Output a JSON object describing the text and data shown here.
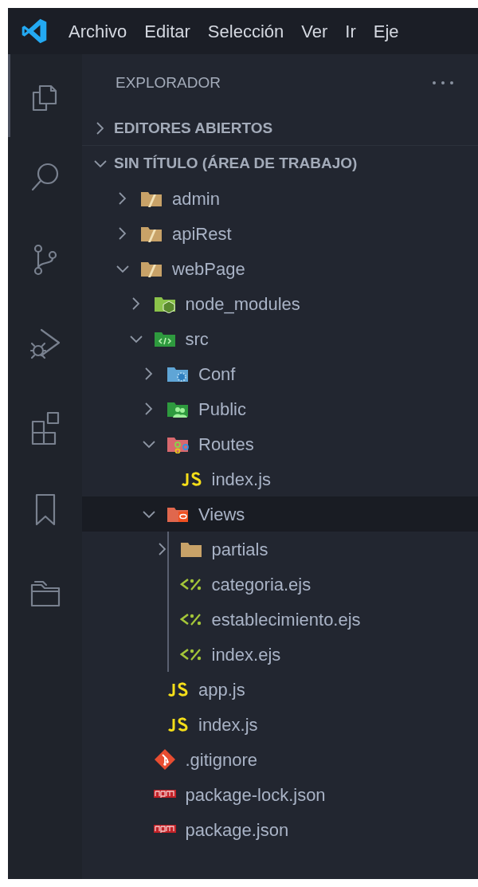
{
  "title_bar": {
    "menu": [
      "Archivo",
      "Editar",
      "Selección",
      "Ver",
      "Ir",
      "Eje"
    ]
  },
  "activity_bar": [
    {
      "kind": "explorer",
      "selected": true
    },
    {
      "kind": "search",
      "selected": false
    },
    {
      "kind": "source-control",
      "selected": false
    },
    {
      "kind": "run-debug",
      "selected": false
    },
    {
      "kind": "extensions",
      "selected": false
    },
    {
      "kind": "bookmarks",
      "selected": false
    },
    {
      "kind": "folders",
      "selected": false
    }
  ],
  "sidebar": {
    "title": "EXPLORADOR",
    "sections": [
      {
        "label": "EDITORES ABIERTOS",
        "expanded": false
      },
      {
        "label": "SIN TÍTULO (ÁREA DE TRABAJO)",
        "expanded": true,
        "tree": [
          {
            "name": "admin",
            "kind": "folder-tan",
            "expanded": false,
            "selected": false
          },
          {
            "name": "apiRest",
            "kind": "folder-tan",
            "expanded": false,
            "selected": false
          },
          {
            "name": "webPage",
            "kind": "folder-tan",
            "expanded": true,
            "selected": false,
            "children": [
              {
                "name": "node_modules",
                "kind": "folder-node",
                "expanded": false,
                "selected": false
              },
              {
                "name": "src",
                "kind": "folder-src",
                "expanded": true,
                "selected": false,
                "children": [
                  {
                    "name": "Conf",
                    "kind": "folder-config",
                    "expanded": false,
                    "selected": false
                  },
                  {
                    "name": "Public",
                    "kind": "folder-public",
                    "expanded": false,
                    "selected": false
                  },
                  {
                    "name": "Routes",
                    "kind": "folder-routes",
                    "expanded": true,
                    "selected": false,
                    "children": [
                      {
                        "name": "index.js",
                        "kind": "js",
                        "selected": false
                      }
                    ]
                  },
                  {
                    "name": "Views",
                    "kind": "folder-views",
                    "expanded": true,
                    "selected": true,
                    "children": [
                      {
                        "name": "partials",
                        "kind": "folder",
                        "expanded": false,
                        "selected": false
                      },
                      {
                        "name": "categoria.ejs",
                        "kind": "ejs",
                        "selected": false
                      },
                      {
                        "name": "establecimiento.ejs",
                        "kind": "ejs",
                        "selected": false
                      },
                      {
                        "name": "index.ejs",
                        "kind": "ejs",
                        "selected": false
                      }
                    ]
                  },
                  {
                    "name": "app.js",
                    "kind": "js",
                    "selected": false
                  },
                  {
                    "name": "index.js",
                    "kind": "js",
                    "selected": false
                  }
                ]
              },
              {
                "name": ".gitignore",
                "kind": "git",
                "selected": false
              },
              {
                "name": "package-lock.json",
                "kind": "npm",
                "selected": false
              },
              {
                "name": "package.json",
                "kind": "npm",
                "selected": false
              }
            ]
          }
        ]
      }
    ]
  }
}
